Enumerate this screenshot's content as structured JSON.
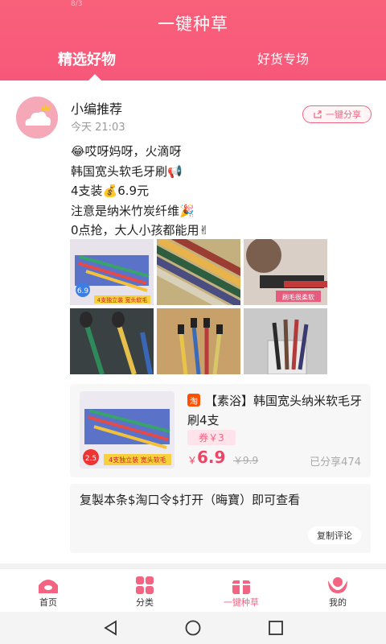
{
  "header": {
    "status_text": "8/3",
    "title": "一键种草",
    "tabs": [
      {
        "label": "精选好物",
        "active": true
      },
      {
        "label": "好货专场",
        "active": false
      }
    ],
    "color": "#f9607a"
  },
  "post": {
    "author": "小编推荐",
    "time": "今天 21:03",
    "share_label": "一键分享",
    "lines": [
      "😂哎呀妈呀，火滴呀",
      "韩国宽头软毛牙刷📢",
      "4支装💰6.9元",
      "注意是纳米竹炭纤维🎉",
      "0点抢，大人小孩都能用✌"
    ],
    "images": [
      {
        "icon": "colorful-toothbrushes-pack",
        "price_tag": "6.9",
        "caption": "4支独立装 宽头软毛"
      },
      {
        "icon": "toothbrush-packages"
      },
      {
        "icon": "black-bristle-closeup",
        "caption": "刷毛很柔软"
      },
      {
        "icon": "toothbrushes-on-dark"
      },
      {
        "icon": "toothbrushes-on-wood"
      },
      {
        "icon": "toothbrushes-in-glass"
      }
    ]
  },
  "product": {
    "badge": "淘",
    "name": "【素浴】韩国宽头纳米软毛牙刷4支",
    "coupon": "券￥3",
    "currency": "￥",
    "price": "6.9",
    "original_price": "￥9.9",
    "shared": "已分享474",
    "image": {
      "price_tag": "2.5",
      "caption": "4支独立装 宽头软毛"
    }
  },
  "copy": {
    "text": "复製本条$淘口令$打开（晦寶）即可查看",
    "button": "复制评论"
  },
  "bottom_nav": [
    {
      "label": "首页",
      "icon": "home-icon",
      "active": false
    },
    {
      "label": "分类",
      "icon": "category-icon",
      "active": false
    },
    {
      "label": "一键种草",
      "icon": "gift-icon",
      "active": true
    },
    {
      "label": "我的",
      "icon": "profile-icon",
      "active": false
    }
  ],
  "accent": "#f36483"
}
